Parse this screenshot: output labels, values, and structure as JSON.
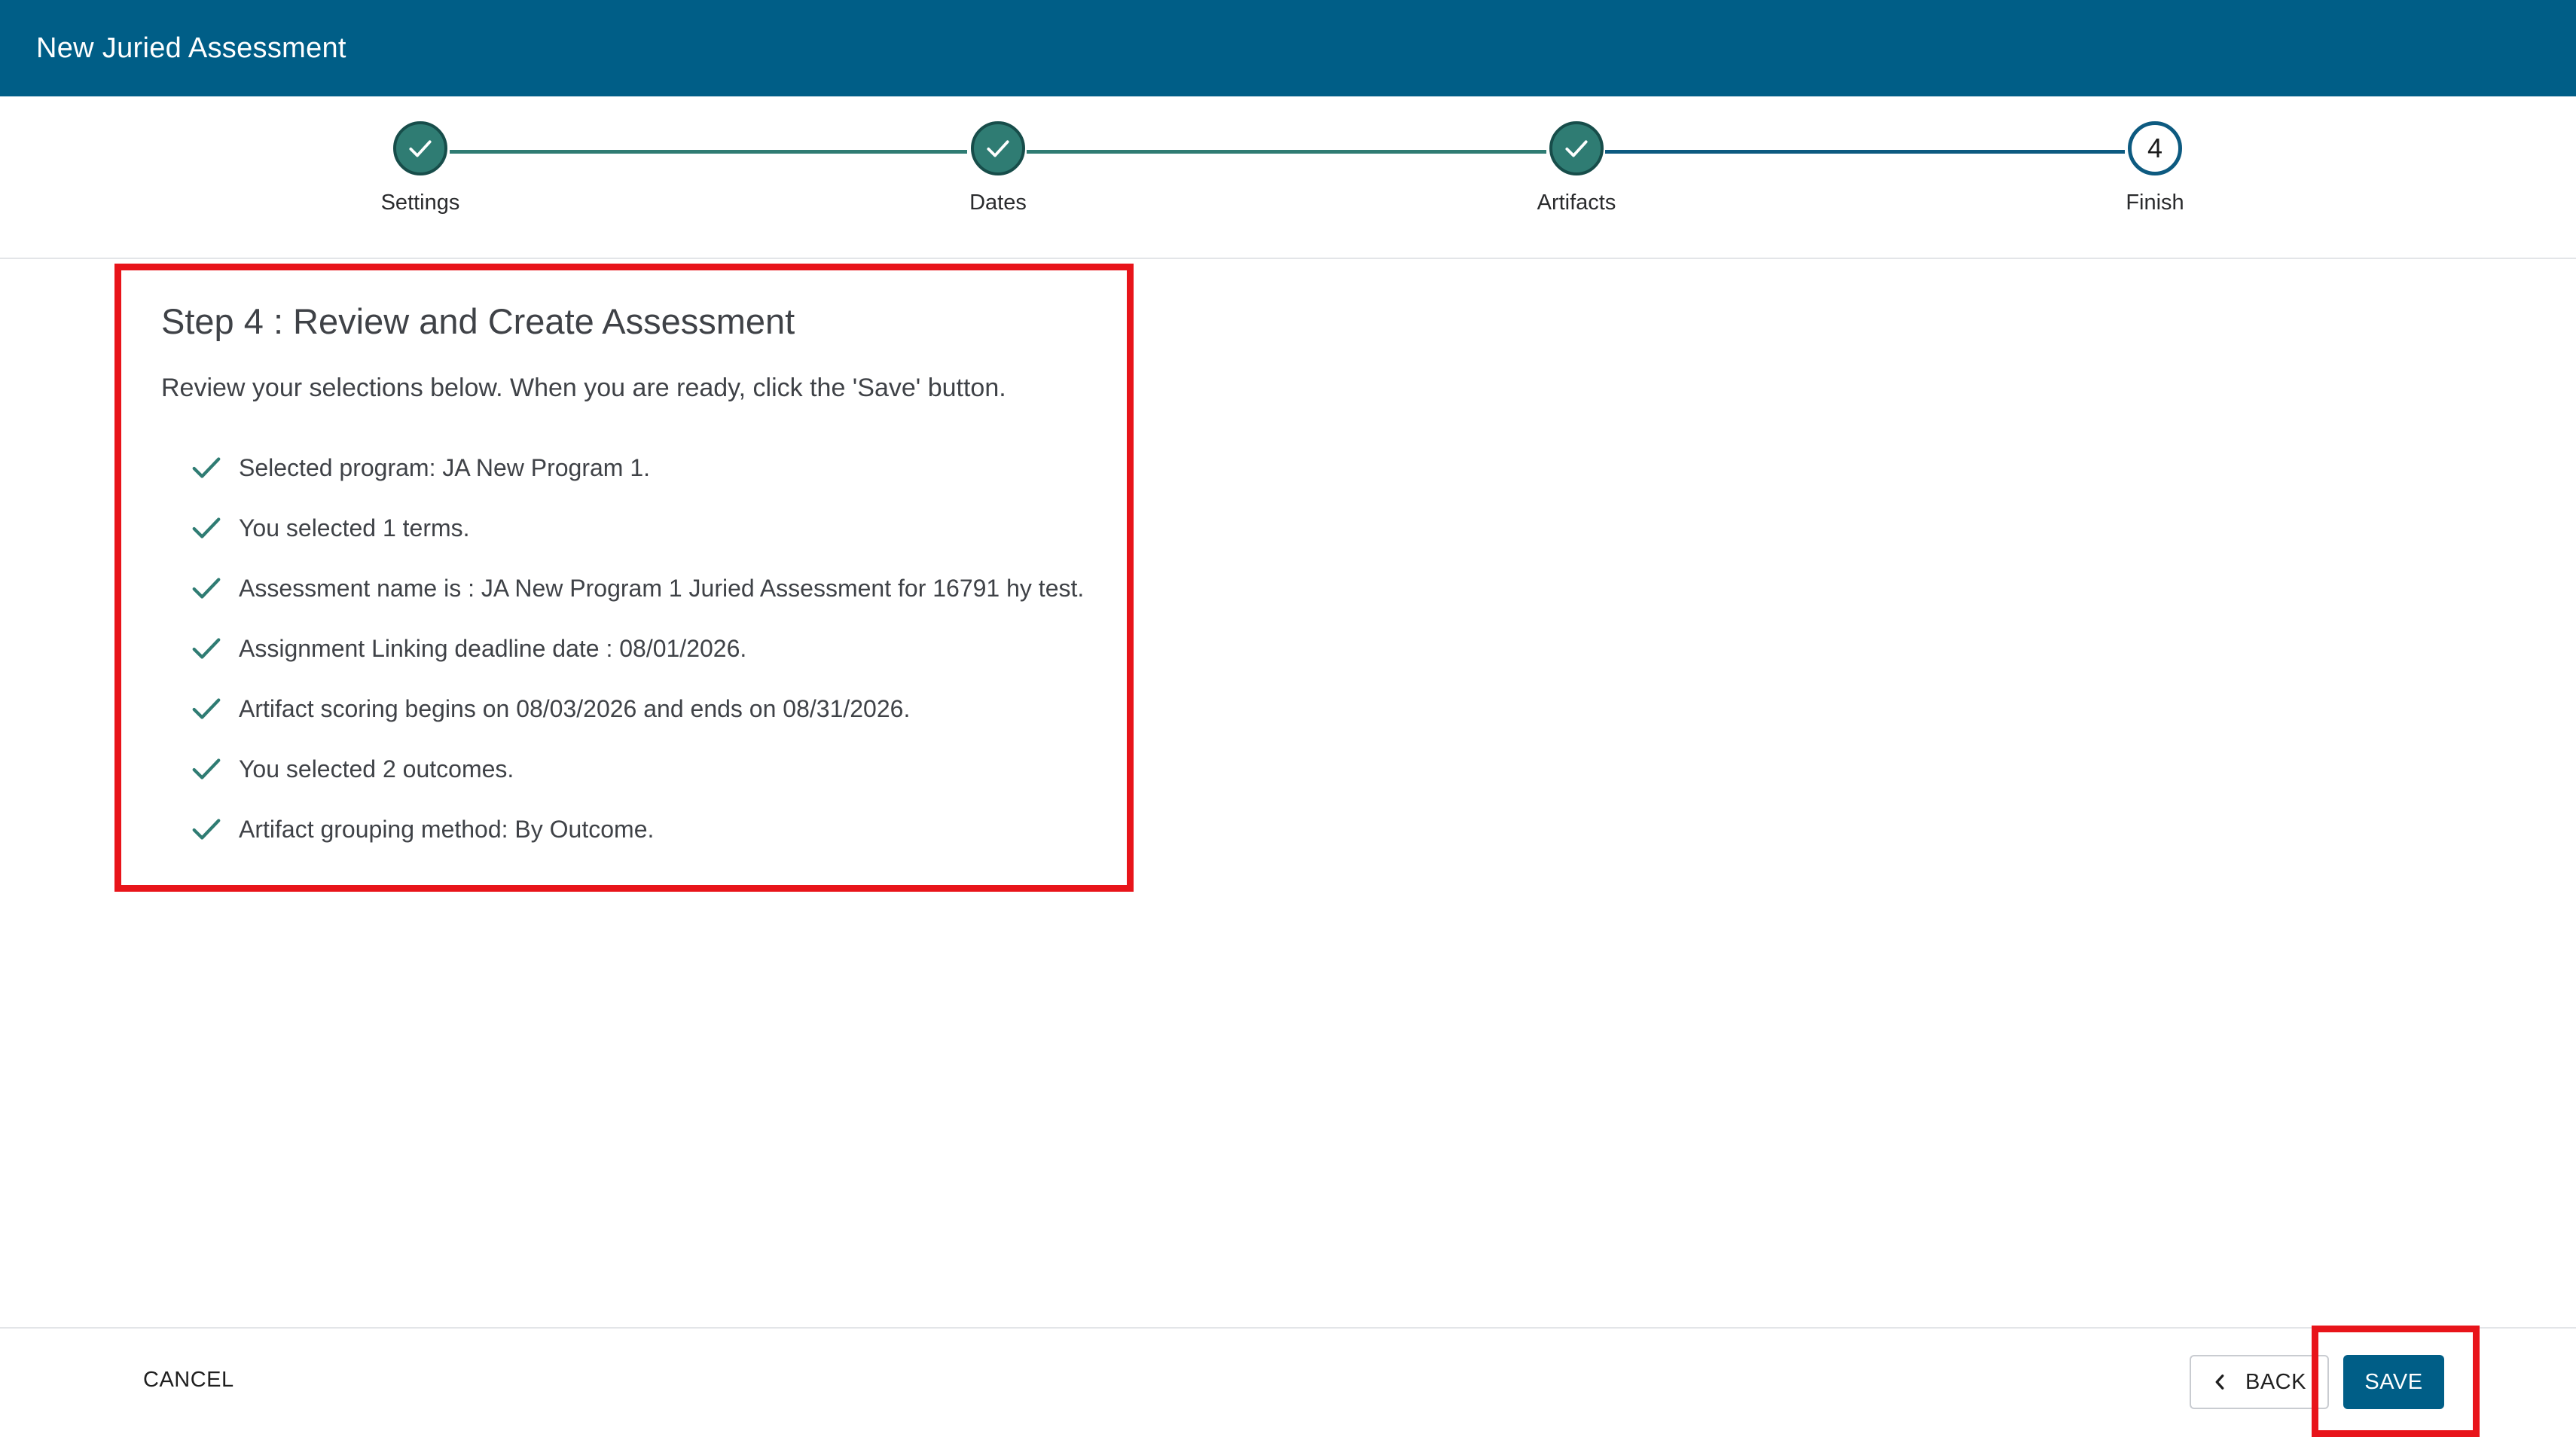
{
  "header": {
    "title": "New Juried Assessment"
  },
  "stepper": {
    "steps": [
      {
        "label": "Settings",
        "state": "completed"
      },
      {
        "label": "Dates",
        "state": "completed"
      },
      {
        "label": "Artifacts",
        "state": "completed"
      },
      {
        "label": "Finish",
        "state": "current",
        "number": "4"
      }
    ]
  },
  "review": {
    "title": "Step 4 : Review and Create Assessment",
    "subtitle": "Review your selections below. When you are ready, click the 'Save' button.",
    "items": [
      "Selected program: JA New Program 1.",
      "You selected 1 terms.",
      "Assessment name is : JA New Program 1 Juried Assessment for 16791 hy test.",
      "Assignment Linking deadline date : 08/01/2026.",
      "Artifact scoring begins on 08/03/2026 and ends on 08/31/2026.",
      "You selected 2 outcomes.",
      "Artifact grouping method: By Outcome."
    ]
  },
  "footer": {
    "cancel_label": "CANCEL",
    "back_label": "BACK",
    "save_label": "SAVE"
  },
  "icons": {
    "step_complete": "check-icon",
    "list_item": "check-icon",
    "back": "chevron-left-icon"
  },
  "colors": {
    "header_background": "#005e87",
    "completed_step": "#2f7c73",
    "current_step_border": "#0d5a80",
    "highlight": "#e8141a",
    "primary_button": "#005e87"
  }
}
